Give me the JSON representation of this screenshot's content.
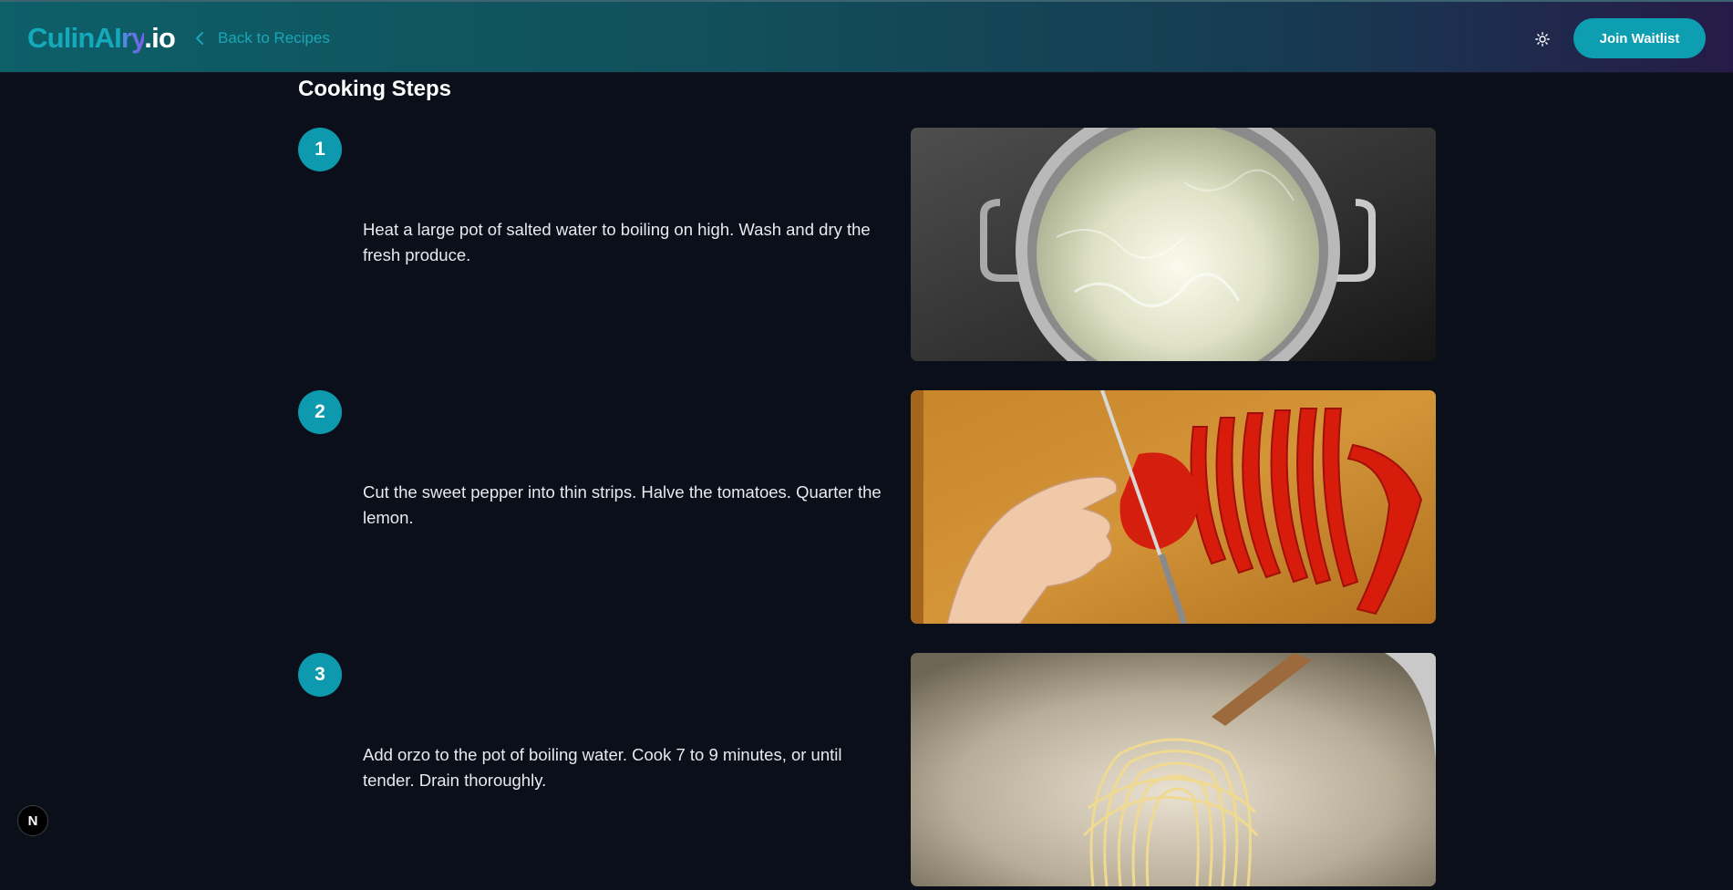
{
  "header": {
    "logo_part1": "CulinAI",
    "logo_part2": "ry",
    "logo_part3": ".io",
    "back_label": "Back to Recipes",
    "theme_icon": "sun-icon",
    "join_label": "Join Waitlist"
  },
  "main": {
    "title": "Cooking Steps",
    "steps": [
      {
        "number": "1",
        "text": "Heat a large pot of salted water to boiling on high. Wash and dry the fresh produce.",
        "image": "boiling-water-pot"
      },
      {
        "number": "2",
        "text": "Cut the sweet pepper into thin strips. Halve the tomatoes. Quarter the lemon.",
        "image": "slicing-red-pepper"
      },
      {
        "number": "3",
        "text": "Add orzo to the pot of boiling water. Cook 7 to 9 minutes, or until tender. Drain thoroughly.",
        "image": "pasta-on-spoon"
      }
    ]
  },
  "dev_badge": "N",
  "colors": {
    "accent": "#0e9eb2",
    "background": "#0a0f1a",
    "logo_teal": "#14a9bb",
    "logo_purple": "#7c5ce6"
  }
}
